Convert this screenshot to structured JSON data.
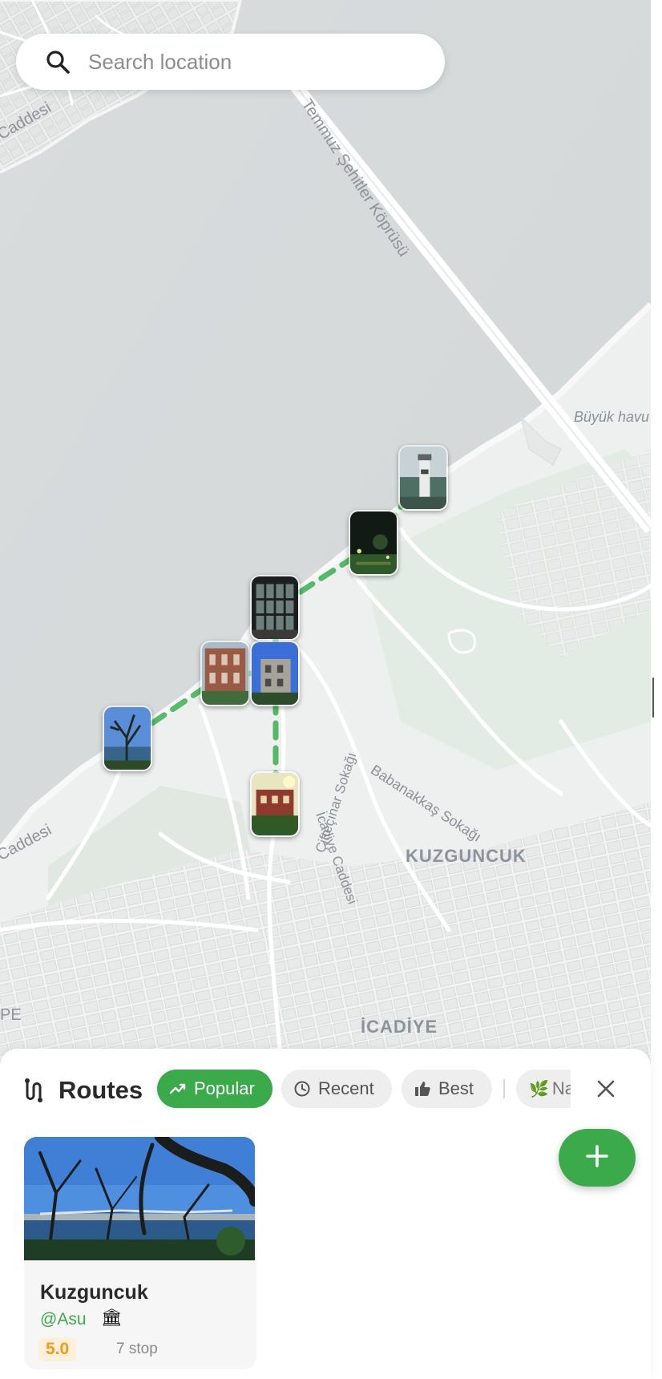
{
  "search": {
    "placeholder": "Search location",
    "icon": "search-icon"
  },
  "map": {
    "labels": {
      "bridge": "Temmuz Şehitler Köprüsü",
      "caddesi_top": "Caddesi",
      "caddesi_bottom": "Caddesi",
      "buyuk": "Büyük havu",
      "babanakkas": "Babanakkaş Sokağı",
      "kuzguncuk": "KUZGUNCUK",
      "icadiye": "İCADİYE",
      "pe": "PE",
      "icadiye_caddesi": "İcadiye Caddesi",
      "ciftecinar": "Çifteçınar Sokağı"
    },
    "markers": [
      {
        "id": "stop-1",
        "photo": "lighthouse"
      },
      {
        "id": "stop-2",
        "photo": "night-garden"
      },
      {
        "id": "stop-3",
        "photo": "window-interior"
      },
      {
        "id": "stop-4",
        "photo": "brick-building"
      },
      {
        "id": "stop-5",
        "photo": "blue-house"
      },
      {
        "id": "stop-6",
        "photo": "tree-bosphorus"
      },
      {
        "id": "stop-7",
        "photo": "red-house"
      }
    ],
    "route_color": "#4cb860"
  },
  "sheet": {
    "title": "Routes",
    "filters": [
      {
        "label": "Popular",
        "icon": "trending-up-icon",
        "active": true
      },
      {
        "label": "Recent",
        "icon": "clock-icon",
        "active": false
      },
      {
        "label": "Best",
        "icon": "thumbs-up-icon",
        "active": false
      },
      {
        "label": "Na",
        "icon": "leaf-icon",
        "active": false
      }
    ],
    "card": {
      "title": "Kuzguncuk",
      "author": "@Asu",
      "badge": "🏛",
      "rating": "5.0",
      "stops": "7 stop"
    }
  },
  "colors": {
    "accent": "#3aaa4a",
    "rating_bg": "#fdf0db",
    "rating_fg": "#f29b14"
  }
}
